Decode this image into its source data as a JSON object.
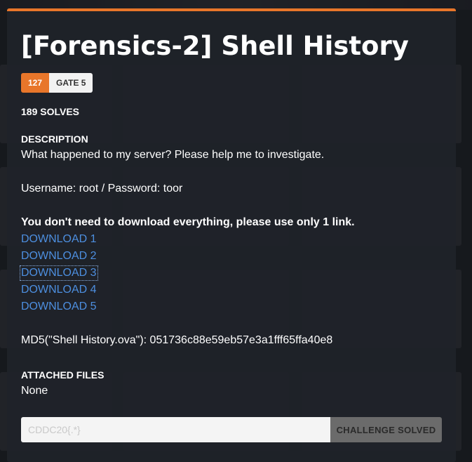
{
  "challenge": {
    "title": "[Forensics-2] Shell History",
    "points": "127",
    "tag": "GATE 5",
    "solves": "189 SOLVES",
    "description_header": "DESCRIPTION",
    "description_line1": "What happened to my server? Please help me to investigate.",
    "credentials": "Username: root / Password: toor",
    "note": "You don't need to download everything, please use only 1 link.",
    "downloads": [
      "DOWNLOAD 1",
      "DOWNLOAD 2",
      "DOWNLOAD 3",
      "DOWNLOAD 4",
      "DOWNLOAD 5"
    ],
    "md5": "MD5(\"Shell History.ova\"): 051736c88e59eb57e3a1fff65ffa40e8",
    "attached_header": "ATTACHED FILES",
    "attached_value": "None"
  },
  "flag_form": {
    "placeholder": "CDDC20{.*}",
    "value": "",
    "button_label": "CHALLENGE SOLVED"
  },
  "colors": {
    "accent": "#e8762a",
    "link": "#4d8fe0",
    "modal_bg": "#202329"
  }
}
